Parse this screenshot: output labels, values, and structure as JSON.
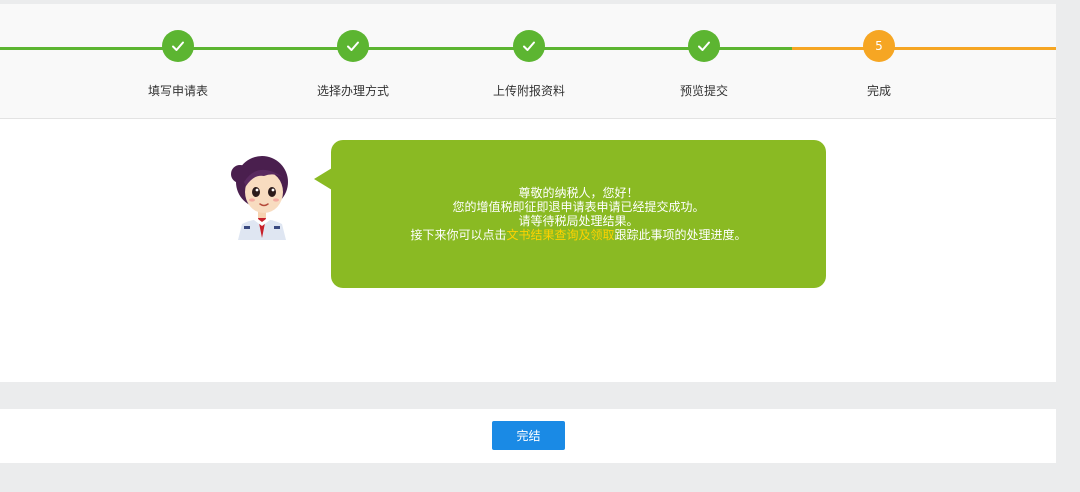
{
  "steps": [
    {
      "label": "填写申请表",
      "status": "done"
    },
    {
      "label": "选择办理方式",
      "status": "done"
    },
    {
      "label": "上传附报资料",
      "status": "done"
    },
    {
      "label": "预览提交",
      "status": "done"
    },
    {
      "label": "完成",
      "status": "active",
      "number": "5"
    }
  ],
  "message": {
    "line1": "尊敬的纳税人，您好！",
    "line2": "您的增值税即征即退申请表申请已经提交成功。",
    "line3": "请等待税局处理结果。",
    "line4_prefix": "接下来你可以点击",
    "line4_link": "文书结果查询及领取",
    "line4_suffix": "跟踪此事项的处理进度。"
  },
  "footer": {
    "finish_label": "完结"
  },
  "colors": {
    "done": "#5cb531",
    "active": "#f6a623",
    "bubble": "#8aba23",
    "link": "#ffd200",
    "button": "#1a8ae5"
  },
  "icons": {
    "check": "checkmark-icon",
    "avatar": "tax-officer-avatar"
  }
}
